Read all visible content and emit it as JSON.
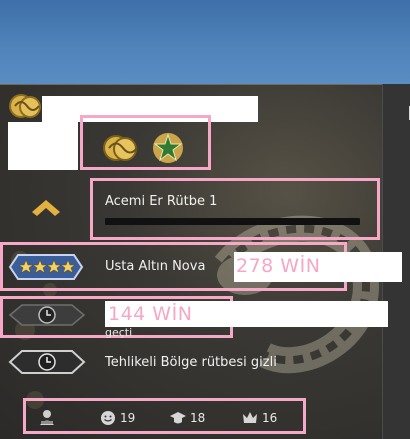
{
  "rank": {
    "name": "Acemi Er Rütbe 1",
    "progress_fraction": 0.0
  },
  "competitive": {
    "rank_name": "Usta Altın Nova",
    "win_overlay": "278 WİN"
  },
  "wingman": {
    "partial_text": "geçti",
    "win_overlay": "144 WİN"
  },
  "danger_zone": {
    "label": "Tehlikeli Bölge rütbesi gizli"
  },
  "commendations": {
    "friendly": "19",
    "teacher": "18",
    "leader": "16"
  },
  "colors": {
    "highlight_frame": "#f5a9c6",
    "win_text": "#f6a7c7",
    "sky": "#4f83ba"
  },
  "icons": [
    "service-coin-icon",
    "gold-coin-icon",
    "star-medal-icon",
    "chevron-up-icon",
    "nova-stars-icon",
    "clock-emblem-icon",
    "trophy-avatar-icon",
    "smile-icon",
    "mortarboard-icon",
    "crown-icon"
  ]
}
